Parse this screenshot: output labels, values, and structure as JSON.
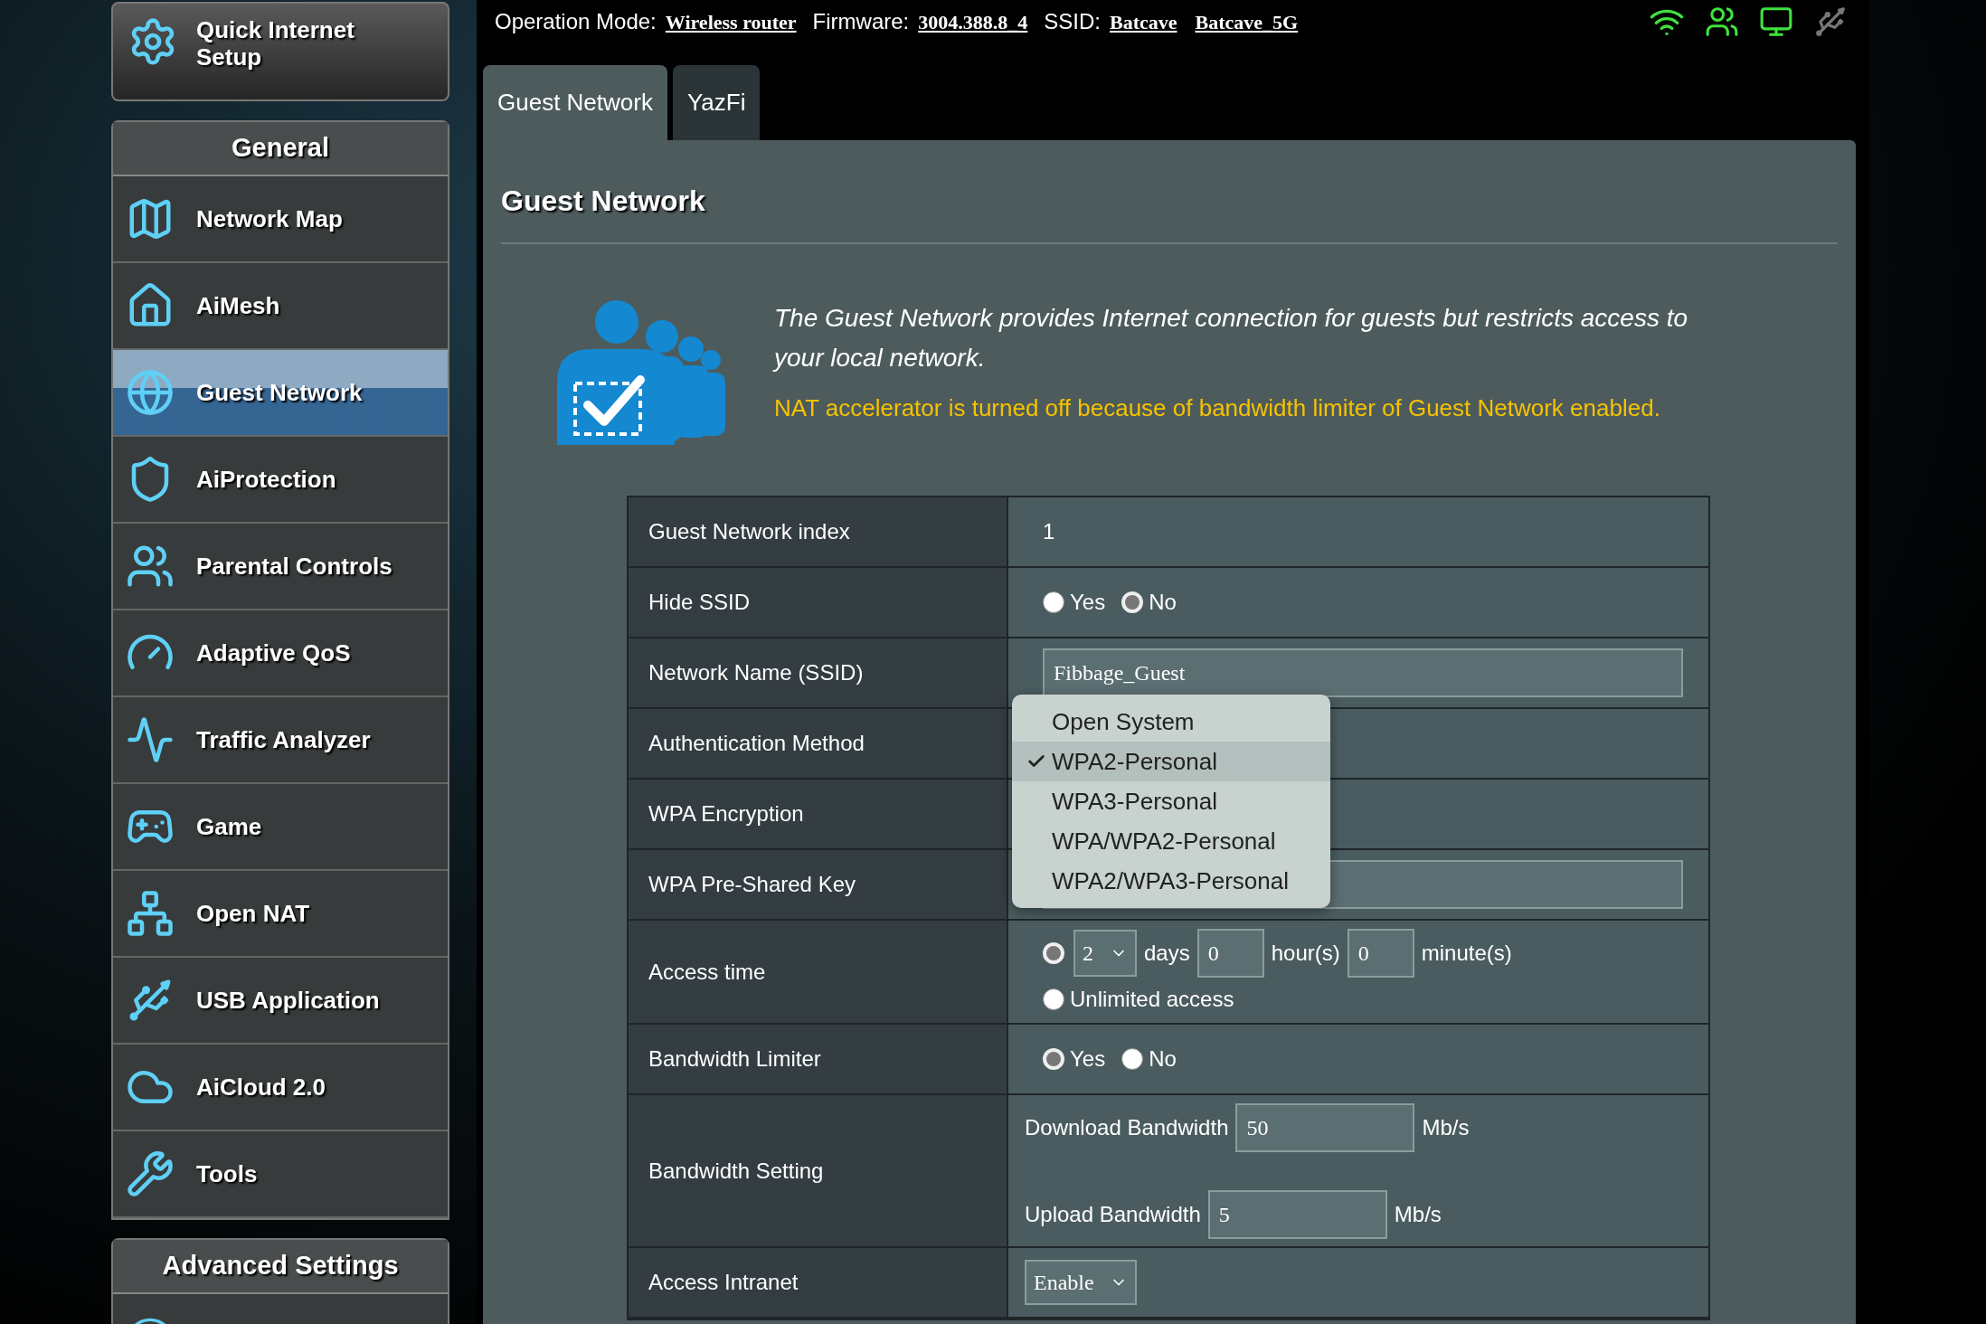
{
  "top_bar": {
    "operation_mode_label": "Operation Mode:",
    "operation_mode": "Wireless router",
    "firmware_label": "Firmware:",
    "firmware": "3004.388.8_4",
    "ssid_label": "SSID:",
    "ssids": [
      "Batcave",
      "Batcave_5G"
    ]
  },
  "sidebar": {
    "quick_setup": "Quick Internet Setup",
    "sections": [
      {
        "title": "General",
        "items": [
          {
            "label": "Network Map",
            "selected": false
          },
          {
            "label": "AiMesh",
            "selected": false
          },
          {
            "label": "Guest Network",
            "selected": true
          },
          {
            "label": "AiProtection",
            "selected": false
          },
          {
            "label": "Parental Controls",
            "selected": false
          },
          {
            "label": "Adaptive QoS",
            "selected": false
          },
          {
            "label": "Traffic Analyzer",
            "selected": false
          },
          {
            "label": "Game",
            "selected": false
          },
          {
            "label": "Open NAT",
            "selected": false
          },
          {
            "label": "USB Application",
            "selected": false
          },
          {
            "label": "AiCloud 2.0",
            "selected": false
          },
          {
            "label": "Tools",
            "selected": false
          }
        ]
      },
      {
        "title": "Advanced Settings"
      }
    ]
  },
  "tabs": [
    {
      "label": "Guest Network",
      "selected": true
    },
    {
      "label": "YazFi",
      "selected": false
    }
  ],
  "panel": {
    "title": "Guest Network",
    "description": "The Guest Network provides Internet connection for guests but restricts access to your local network.",
    "notice": "NAT accelerator is turned off because of bandwidth limiter of Guest Network enabled."
  },
  "settings": [
    {
      "kind": "text",
      "label": "Guest Network index",
      "value": "1"
    },
    {
      "kind": "radio",
      "label": "Hide SSID",
      "options": [
        {
          "label": "Yes",
          "selected": false
        },
        {
          "label": "No",
          "selected": true
        }
      ]
    },
    {
      "kind": "input",
      "label": "Network Name (SSID)",
      "value": "Fibbage_Guest"
    },
    {
      "kind": "blank",
      "label": "Authentication Method"
    },
    {
      "kind": "blank",
      "label": "WPA Encryption"
    },
    {
      "kind": "input",
      "label": "WPA Pre-Shared Key"
    },
    {
      "kind": "access_time",
      "label": "Access time",
      "limited": {
        "selected": true,
        "days": "2",
        "days_label": "days",
        "hours": "0",
        "hours_label": "hour(s)",
        "minutes": "0",
        "minutes_label": "minute(s)"
      },
      "unlimited": {
        "selected": false,
        "label": "Unlimited access"
      }
    },
    {
      "kind": "radio",
      "label": "Bandwidth Limiter",
      "options": [
        {
          "label": "Yes",
          "selected": true
        },
        {
          "label": "No",
          "selected": false
        }
      ]
    },
    {
      "kind": "bandwidth",
      "label": "Bandwidth Setting",
      "fields": [
        {
          "label": "Download Bandwidth",
          "value": "50",
          "unit": "Mb/s"
        },
        {
          "label": "Upload Bandwidth",
          "value": "5",
          "unit": "Mb/s"
        }
      ]
    },
    {
      "kind": "select",
      "label": "Access Intranet",
      "value": "Enable"
    }
  ],
  "dropdown": {
    "options": [
      {
        "label": "Open System",
        "selected": false
      },
      {
        "label": "WPA2-Personal",
        "selected": true
      },
      {
        "label": "WPA3-Personal",
        "selected": false
      },
      {
        "label": "WPA/WPA2-Personal",
        "selected": false
      },
      {
        "label": "WPA2/WPA3-Personal",
        "selected": false
      }
    ]
  }
}
